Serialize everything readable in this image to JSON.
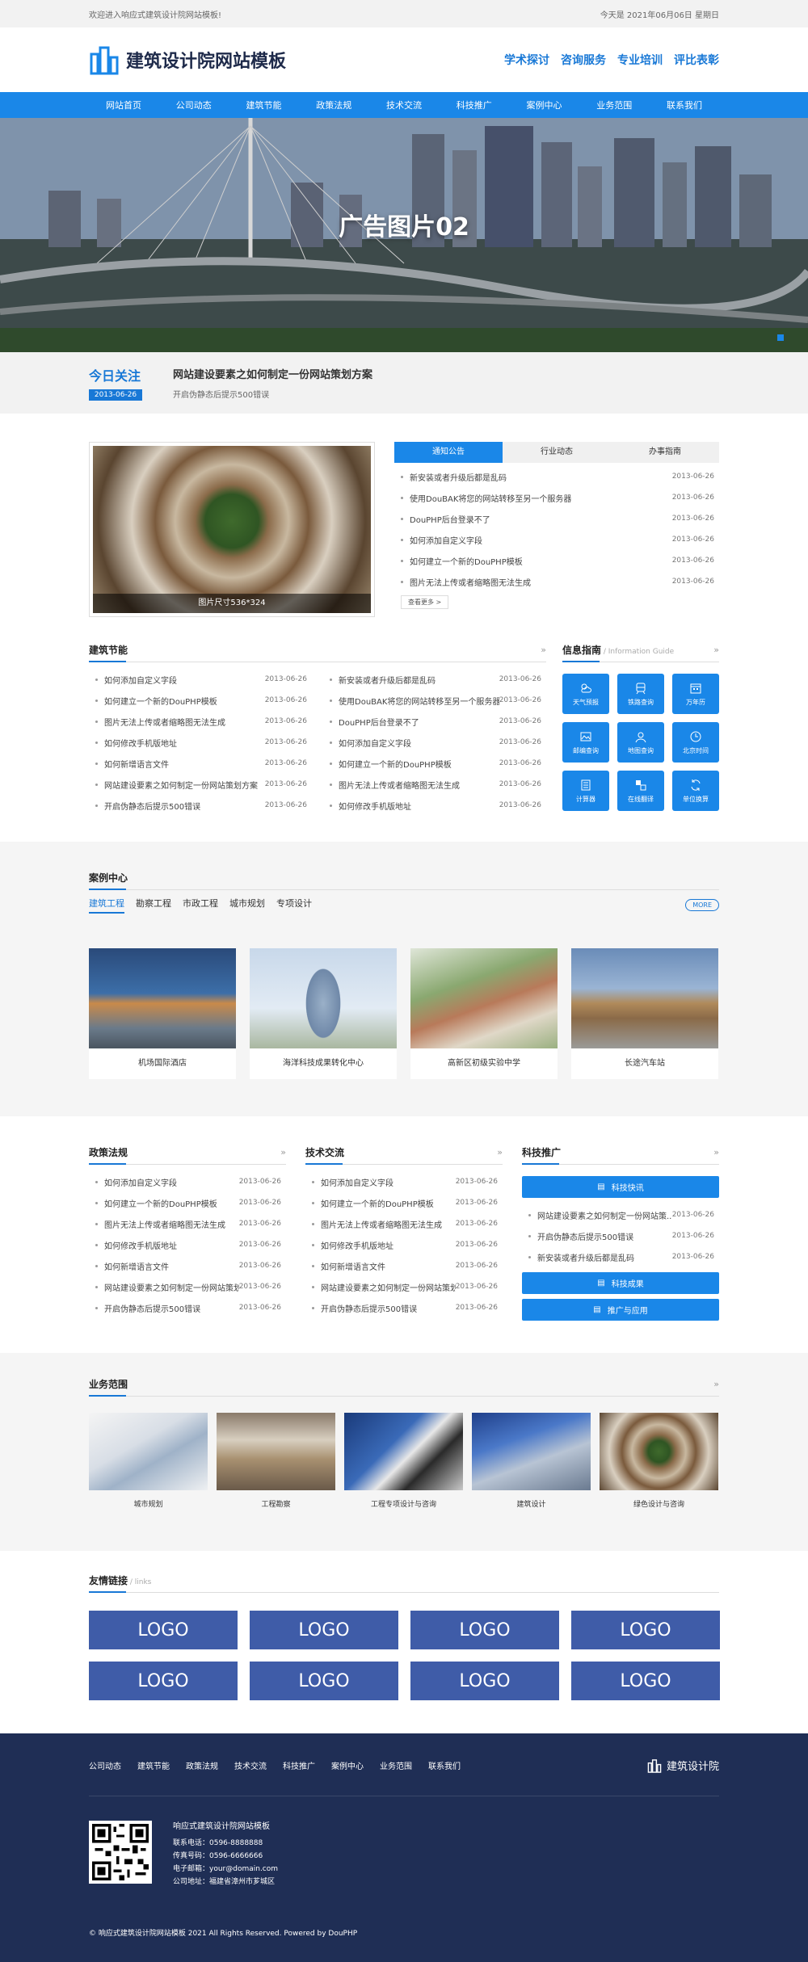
{
  "topbar": {
    "welcome": "欢迎进入响应式建筑设计院网站模板!",
    "date": "今天是 2021年06月06日 星期日"
  },
  "header": {
    "site_name": "建筑设计院网站模板",
    "links": [
      "学术探讨",
      "咨询服务",
      "专业培训",
      "评比表彰"
    ]
  },
  "nav": [
    "网站首页",
    "公司动态",
    "建筑节能",
    "政策法规",
    "技术交流",
    "科技推广",
    "案例中心",
    "业务范围",
    "联系我们"
  ],
  "banner": {
    "caption": "广告图片02"
  },
  "today": {
    "title": "今日关注",
    "date": "2013-06-26",
    "headline": "网站建设要素之如何制定一份网站策划方案",
    "desc": "开启伪静态后提示500错误"
  },
  "photo": {
    "caption": "图片尺寸536*324"
  },
  "notice": {
    "tabs": [
      "通知公告",
      "行业动态",
      "办事指南"
    ],
    "items": [
      {
        "t": "新安装或者升级后都是乱码",
        "d": "2013-06-26"
      },
      {
        "t": "使用DouBAK将您的网站转移至另一个服务器",
        "d": "2013-06-26"
      },
      {
        "t": "DouPHP后台登录不了",
        "d": "2013-06-26"
      },
      {
        "t": "如何添加自定义字段",
        "d": "2013-06-26"
      },
      {
        "t": "如何建立一个新的DouPHP模板",
        "d": "2013-06-26"
      },
      {
        "t": "图片无法上传或者缩略图无法生成",
        "d": "2013-06-26"
      }
    ],
    "more": "查看更多 >"
  },
  "energy": {
    "title": "建筑节能",
    "col1": [
      {
        "t": "如何添加自定义字段",
        "d": "2013-06-26"
      },
      {
        "t": "如何建立一个新的DouPHP模板",
        "d": "2013-06-26"
      },
      {
        "t": "图片无法上传或者缩略图无法生成",
        "d": "2013-06-26"
      },
      {
        "t": "如何修改手机版地址",
        "d": "2013-06-26"
      },
      {
        "t": "如何新增语言文件",
        "d": "2013-06-26"
      },
      {
        "t": "网站建设要素之如何制定一份网站策划方案",
        "d": "2013-06-26"
      },
      {
        "t": "开启伪静态后提示500错误",
        "d": "2013-06-26"
      }
    ],
    "col2": [
      {
        "t": "新安装或者升级后都是乱码",
        "d": "2013-06-26"
      },
      {
        "t": "使用DouBAK将您的网站转移至另一个服务器",
        "d": "2013-06-26"
      },
      {
        "t": "DouPHP后台登录不了",
        "d": "2013-06-26"
      },
      {
        "t": "如何添加自定义字段",
        "d": "2013-06-26"
      },
      {
        "t": "如何建立一个新的DouPHP模板",
        "d": "2013-06-26"
      },
      {
        "t": "图片无法上传或者缩略图无法生成",
        "d": "2013-06-26"
      },
      {
        "t": "如何修改手机版地址",
        "d": "2013-06-26"
      }
    ]
  },
  "info": {
    "title": "信息指南",
    "subtitle": " / Information Guide",
    "cells": [
      {
        "label": "天气预报",
        "icon": "weather-icon"
      },
      {
        "label": "铁路查询",
        "icon": "train-icon"
      },
      {
        "label": "万年历",
        "icon": "calendar-icon"
      },
      {
        "label": "邮编查询",
        "icon": "mail-icon"
      },
      {
        "label": "地图查询",
        "icon": "map-icon"
      },
      {
        "label": "北京时间",
        "icon": "clock-icon"
      },
      {
        "label": "计算器",
        "icon": "calculator-icon"
      },
      {
        "label": "在线翻译",
        "icon": "translate-icon"
      },
      {
        "label": "单位换算",
        "icon": "convert-icon"
      }
    ]
  },
  "cases": {
    "title": "案例中心",
    "tabs": [
      "建筑工程",
      "勘察工程",
      "市政工程",
      "城市规划",
      "专项设计"
    ],
    "more": "MORE",
    "items": [
      "机场国际酒店",
      "海洋科技成果转化中心",
      "高新区初级实验中学",
      "长途汽车站"
    ]
  },
  "policy": {
    "title": "政策法规",
    "items": [
      {
        "t": "如何添加自定义字段",
        "d": "2013-06-26"
      },
      {
        "t": "如何建立一个新的DouPHP模板",
        "d": "2013-06-26"
      },
      {
        "t": "图片无法上传或者缩略图无法生成",
        "d": "2013-06-26"
      },
      {
        "t": "如何修改手机版地址",
        "d": "2013-06-26"
      },
      {
        "t": "如何新增语言文件",
        "d": "2013-06-26"
      },
      {
        "t": "网站建设要素之如何制定一份网站策划...",
        "d": "2013-06-26"
      },
      {
        "t": "开启伪静态后提示500错误",
        "d": "2013-06-26"
      }
    ]
  },
  "tech": {
    "title": "技术交流",
    "items": [
      {
        "t": "如何添加自定义字段",
        "d": "2013-06-26"
      },
      {
        "t": "如何建立一个新的DouPHP模板",
        "d": "2013-06-26"
      },
      {
        "t": "图片无法上传或者缩略图无法生成",
        "d": "2013-06-26"
      },
      {
        "t": "如何修改手机版地址",
        "d": "2013-06-26"
      },
      {
        "t": "如何新增语言文件",
        "d": "2013-06-26"
      },
      {
        "t": "网站建设要素之如何制定一份网站策划...",
        "d": "2013-06-26"
      },
      {
        "t": "开启伪静态后提示500错误",
        "d": "2013-06-26"
      }
    ]
  },
  "promo": {
    "title": "科技推广",
    "btn1": "科技快讯",
    "items": [
      {
        "t": "网站建设要素之如何制定一份网站策...",
        "d": "2013-06-26"
      },
      {
        "t": "开启伪静态后提示500错误",
        "d": "2013-06-26"
      },
      {
        "t": "新安装或者升级后都是乱码",
        "d": "2013-06-26"
      }
    ],
    "btn2": "科技成果",
    "btn3": "推广与应用"
  },
  "business": {
    "title": "业务范围",
    "items": [
      "城市规划",
      "工程勘察",
      "工程专项设计与咨询",
      "建筑设计",
      "绿色设计与咨询"
    ]
  },
  "friends": {
    "title": "友情链接",
    "subtitle": " / links",
    "logos": [
      "LOGO",
      "LOGO",
      "LOGO",
      "LOGO",
      "LOGO",
      "LOGO",
      "LOGO",
      "LOGO"
    ]
  },
  "footer": {
    "links": [
      "公司动态",
      "建筑节能",
      "政策法规",
      "技术交流",
      "科技推广",
      "案例中心",
      "业务范围",
      "联系我们"
    ],
    "brand": "建筑设计院",
    "name": "响应式建筑设计院网站模板",
    "phone": "联系电话：0596-8888888",
    "fax": "传真号码：0596-6666666",
    "email": "电子邮箱：your@domain.com",
    "address": "公司地址：福建省漳州市芗城区",
    "copyright": "© 响应式建筑设计院网站模板 2021 All Rights Reserved. Powered by DouPHP"
  },
  "colors": {
    "primary": "#1a87e8",
    "footer_bg": "#1f2e55",
    "logo_box": "#3f5ca8"
  }
}
